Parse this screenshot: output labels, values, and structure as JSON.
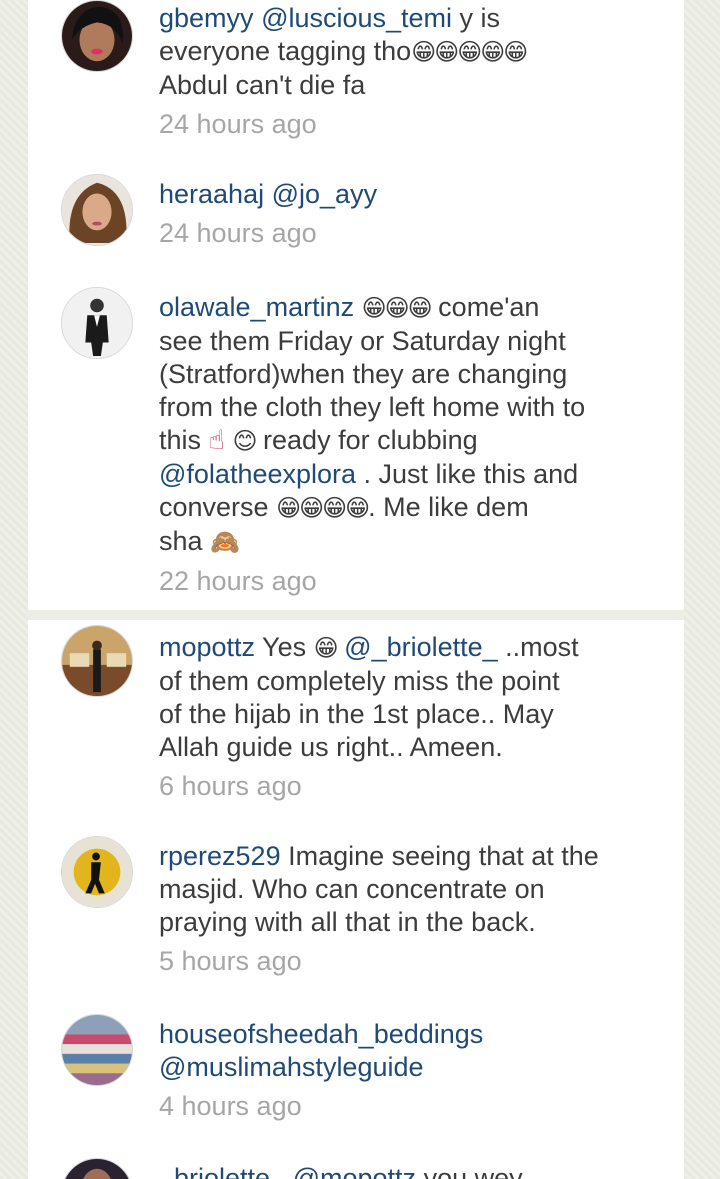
{
  "comments": [
    {
      "username": "gbemyy",
      "mention": "@luscious_temi",
      "text1": " y is",
      "line2": "everyone tagging tho",
      "emoji2": "😁😁😁😁😁",
      "line3": "Abdul can't die fa",
      "time": "24 hours ago"
    },
    {
      "username": "heraahaj",
      "mention": "@jo_ayy",
      "time": "24 hours ago"
    },
    {
      "username": "olawale_martinz",
      "emoji1": "😁😁😁",
      "text1": " come'an",
      "line2": "see them Friday or Saturday night",
      "line3": "(Stratford)when they are changing",
      "line4": "from the cloth they left home with to",
      "line5a": "this ",
      "emoji5a": "☝",
      "emoji5b": "😊",
      "line5b": " ready for clubbing",
      "mention": "@folatheexplora",
      "line6": " . Just like this and",
      "line7a": "converse ",
      "emoji7": "😁😁😁😁",
      "line7b": ". Me like dem",
      "line8": "sha ",
      "emoji8": "🙈",
      "time": "22 hours ago"
    },
    {
      "username": "mopottz",
      "text1a": " Yes ",
      "emoji1": "😁",
      "mention": "@_briolette_",
      "text1b": " ..most",
      "line2": "of them completely miss the point",
      "line3": "of the hijab in the 1st place.. May",
      "line4": "Allah guide us right.. Ameen.",
      "time": "6 hours ago"
    },
    {
      "username": "rperez529",
      "text1": " Imagine seeing that at the",
      "line2": "masjid. Who can concentrate on",
      "line3": "praying with all that in the back.",
      "time": "5 hours ago"
    },
    {
      "username": "houseofsheedah_beddings",
      "mention": "@muslimahstyleguide",
      "time": "4 hours ago"
    },
    {
      "username": "_briolette_",
      "mention": "@mopottz",
      "text1": " you wey"
    }
  ],
  "colors": {
    "username": "#1f4a77",
    "text": "#3c3c3c",
    "timestamp": "#a6a6a6",
    "background": "#eceee6",
    "card": "#ffffff"
  }
}
